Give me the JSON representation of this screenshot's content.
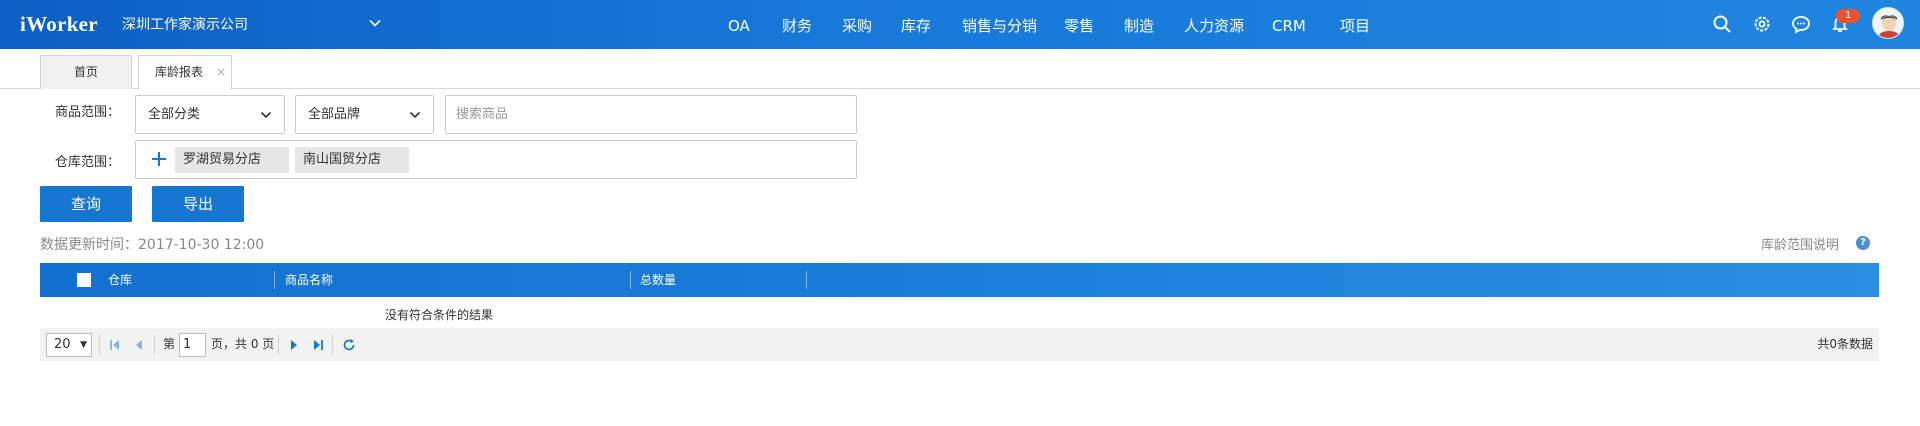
{
  "app": {
    "logo": "iWorker",
    "company": "深圳工作家演示公司"
  },
  "nav": {
    "items": [
      "OA",
      "财务",
      "采购",
      "库存",
      "销售与分销",
      "零售",
      "制造",
      "人力资源",
      "CRM",
      "项目"
    ]
  },
  "topbar": {
    "icons": [
      "search-icon",
      "gear-icon",
      "chat-icon",
      "bell-icon"
    ],
    "notification_count": "1"
  },
  "tabs": {
    "home": "首页",
    "report": "库龄报表",
    "close": "×"
  },
  "filters": {
    "product_range_label": "商品范围：",
    "category_value": "全部分类",
    "brand_value": "全部品牌",
    "search_placeholder": "搜索商品",
    "warehouse_range_label": "仓库范围：",
    "warehouses": [
      "罗湖贸易分店",
      "南山国贸分店"
    ]
  },
  "actions": {
    "query": "查询",
    "export": "导出"
  },
  "info": {
    "update_time": "数据更新时间：2017-10-30 12:00",
    "age_range_help": "库龄范围说明",
    "help_glyph": "?"
  },
  "table": {
    "columns": [
      "仓库",
      "商品名称",
      "总数量"
    ],
    "empty_text": "没有符合条件的结果"
  },
  "pager": {
    "page_size": "20",
    "page_prefix": "第",
    "current_page": "1",
    "page_suffix": "页，共 0 页",
    "total": "共0条数据"
  },
  "colors": {
    "brand_blue": "#1677d2",
    "badge_red": "#f0522e"
  }
}
